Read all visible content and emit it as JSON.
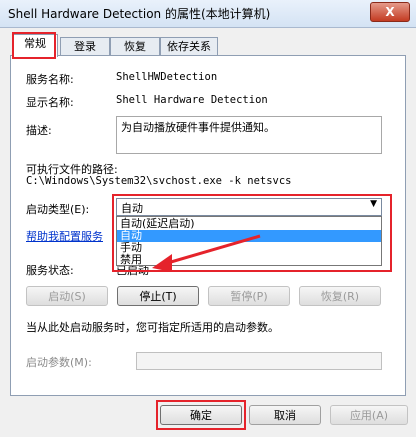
{
  "window": {
    "title": "Shell Hardware Detection 的属性(本地计算机)",
    "close_label": "X"
  },
  "tabs": [
    "常规",
    "登录",
    "恢复",
    "依存关系"
  ],
  "general": {
    "service_name_label": "服务名称:",
    "service_name_value": "ShellHWDetection",
    "display_name_label": "显示名称:",
    "display_name_value": "Shell Hardware Detection",
    "description_label": "描述:",
    "description_value": "为自动播放硬件事件提供通知。",
    "exe_path_label": "可执行文件的路径:",
    "exe_path_value": "C:\\Windows\\System32\\svchost.exe -k netsvcs",
    "startup_type_label": "启动类型(E):",
    "startup_type_value": "自动",
    "startup_type_options": [
      "自动(延迟启动)",
      "自动",
      "手动",
      "禁用"
    ],
    "help_link": "帮助我配置服务",
    "service_status_label": "服务状态:",
    "service_status_value": "已启动",
    "buttons": {
      "start": "启动(S)",
      "stop": "停止(T)",
      "pause": "暂停(P)",
      "resume": "恢复(R)"
    },
    "hint_text": "当从此处启动服务时，您可指定所适用的启动参数。",
    "start_params_label": "启动参数(M):",
    "start_params_value": ""
  },
  "footer": {
    "ok": "确定",
    "cancel": "取消",
    "apply": "应用(A)"
  },
  "colors": {
    "annotation_red": "#e5232b",
    "selection_blue": "#3399ff"
  }
}
